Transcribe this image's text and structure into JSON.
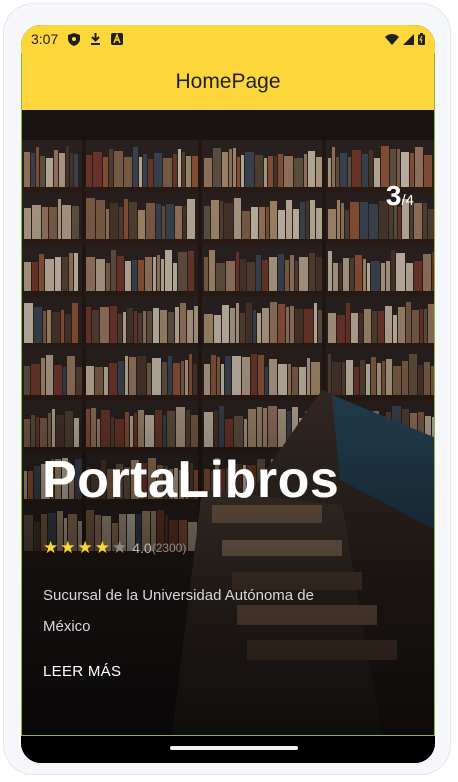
{
  "status_bar": {
    "time": "3:07",
    "icons_left": [
      "shield-icon",
      "download-icon",
      "a-badge-icon"
    ],
    "icons_right": [
      "wifi-icon",
      "signal-icon",
      "battery-icon"
    ]
  },
  "app_bar": {
    "title": "HomePage",
    "background_color": "#fcd73b"
  },
  "carousel": {
    "current_page": "3",
    "separator": "/",
    "total_pages": "4"
  },
  "place": {
    "title": "PortaLibros",
    "rating": {
      "stars_filled": 4,
      "stars_total": 5,
      "value": "4.0",
      "count": "(2300)"
    },
    "description": "Sucursal de la Universidad Autónoma de México",
    "read_more_label": "LEER MÁS"
  },
  "colors": {
    "accent": "#fcd73b",
    "star": "#ffd92f",
    "frame_line": "#8db43b"
  }
}
